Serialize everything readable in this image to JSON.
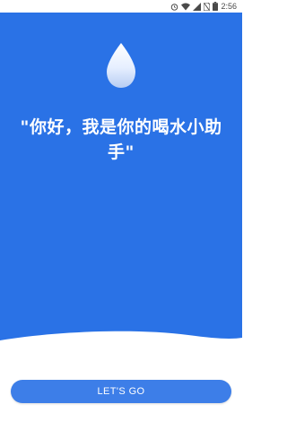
{
  "status_bar": {
    "time": "2:56",
    "icons": [
      "alarm-icon",
      "wifi-icon",
      "signal-icon",
      "no-sim-icon",
      "battery-icon"
    ]
  },
  "hero": {
    "icon": "water-drop-icon",
    "greeting": "\"你好，我是你的喝水小助手\""
  },
  "actions": {
    "start_label": "LET'S GO"
  },
  "colors": {
    "hero_blue": "#2a72e6",
    "button_blue": "#3d7ee8",
    "text_white": "#ffffff"
  }
}
